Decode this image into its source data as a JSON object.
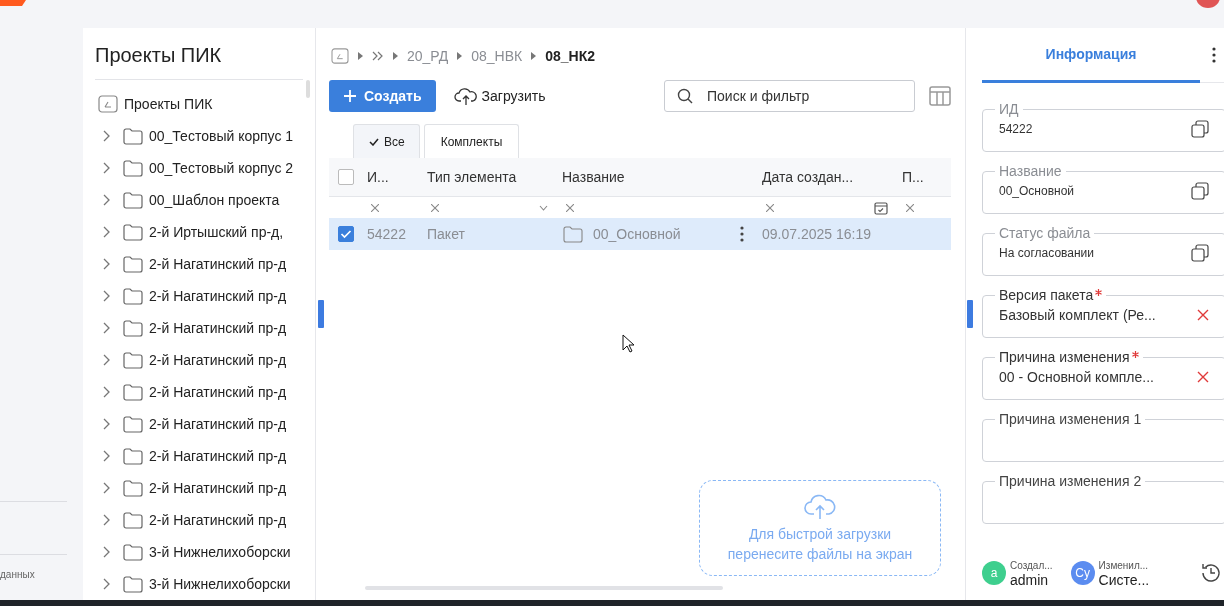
{
  "sidebar": {
    "footer_text": "данных"
  },
  "project_tree": {
    "title": "Проекты ПИК",
    "root": "Проекты ПИК",
    "items": [
      {
        "label": "00_Тестовый корпус 1",
        "expanded": false
      },
      {
        "label": "00_Тестовый корпус 2",
        "expanded": false
      },
      {
        "label": "00_Шаблон проекта",
        "expanded": false
      },
      {
        "label": "2-й Иртышский пр-д,",
        "expanded": false
      },
      {
        "label": "2-й Нагатинский пр-д",
        "expanded": false
      },
      {
        "label": "2-й Нагатинский пр-д",
        "expanded": false
      },
      {
        "label": "2-й Нагатинский пр-д",
        "expanded": false
      },
      {
        "label": "2-й Нагатинский пр-д",
        "expanded": false
      },
      {
        "label": "2-й Нагатинский пр-д",
        "expanded": false
      },
      {
        "label": "2-й Нагатинский пр-д",
        "expanded": false
      },
      {
        "label": "2-й Нагатинский пр-д",
        "expanded": false
      },
      {
        "label": "2-й Нагатинский пр-д",
        "expanded": false
      },
      {
        "label": "2-й Нагатинский пр-д",
        "expanded": false
      },
      {
        "label": "3-й Нижнелихоборски",
        "expanded": false
      },
      {
        "label": "3-й Нижнелихоборски",
        "expanded": false
      }
    ]
  },
  "breadcrumb": [
    {
      "label": "20_РД",
      "current": false
    },
    {
      "label": "08_НВК",
      "current": false
    },
    {
      "label": "08_НК2",
      "current": true
    }
  ],
  "toolbar": {
    "create": "Создать",
    "upload": "Загрузить",
    "search": {
      "placeholder": "Поиск и фильтр"
    }
  },
  "tabs": [
    {
      "label": "Все",
      "selected": true
    },
    {
      "label": "Комплекты",
      "selected": false
    }
  ],
  "table": {
    "all_checked": false,
    "columns": [
      {
        "label": "И...",
        "kind": "text"
      },
      {
        "label": "Тип элемента",
        "kind": "select"
      },
      {
        "label": "Название",
        "kind": "text"
      },
      {
        "label": "Дата создан...",
        "kind": "date"
      },
      {
        "label": "П...",
        "kind": "text"
      }
    ],
    "rows": [
      {
        "checked": true,
        "selected": true,
        "id": "54222",
        "type": "Пакет",
        "name": "00_Основной",
        "created": "09.07.2025 16:19"
      }
    ]
  },
  "drop_zone": {
    "lines": [
      "Для быстрой загрузки",
      "перенесите файлы на экран"
    ]
  },
  "info_panel": {
    "tab": "Информация",
    "fields": [
      {
        "label": "ИД",
        "value": "54222",
        "required": false,
        "kind": "readonly"
      },
      {
        "label": "Название",
        "value": "00_Основной",
        "required": false,
        "kind": "readonly"
      },
      {
        "label": "Статус файла",
        "value": "На согласовании",
        "required": false,
        "kind": "readonly"
      },
      {
        "label": "Версия пакета",
        "value": "Базовый комплект (Ре...",
        "required": true,
        "kind": "select"
      },
      {
        "label": "Причина изменения",
        "value": "00 - Основной компле...",
        "required": true,
        "kind": "select"
      },
      {
        "label": "Причина изменения 1",
        "required": false,
        "kind": "input"
      },
      {
        "label": "Причина изменения 2",
        "required": false,
        "kind": "input"
      }
    ],
    "footer": [
      {
        "avatar": "a",
        "color": "#3ecf8e",
        "caption": "Создал...",
        "name": "admin"
      },
      {
        "avatar": "Су",
        "color": "#5b8cf0",
        "caption": "Изменил...",
        "name": "Систе..."
      }
    ]
  }
}
